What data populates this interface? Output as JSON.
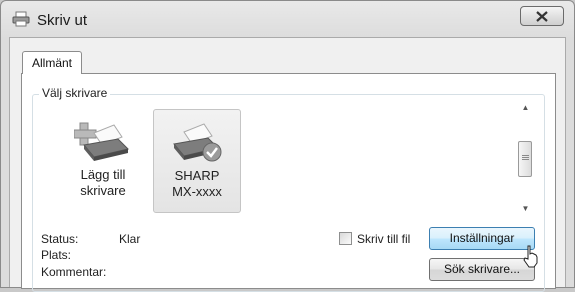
{
  "window": {
    "title": "Skriv ut",
    "icon": "printer-icon",
    "close_icon": "close-icon"
  },
  "tabs": [
    {
      "label": "Allmänt",
      "selected": true
    }
  ],
  "group": {
    "title": "Välj skrivare"
  },
  "printers": [
    {
      "line1": "Lägg till",
      "line2": "skrivare",
      "icon": "add-printer-icon",
      "selected": false
    },
    {
      "line1": "SHARP",
      "line2": "MX-xxxx",
      "icon": "printer-default-icon",
      "selected": true
    }
  ],
  "info": {
    "status_label": "Status:",
    "status_value": "Klar",
    "location_label": "Plats:",
    "comment_label": "Kommentar:"
  },
  "print_to_file": {
    "label": "Skriv till fil",
    "checked": false
  },
  "buttons": {
    "settings": "Inställningar",
    "find_printer": "Sök skrivare..."
  }
}
